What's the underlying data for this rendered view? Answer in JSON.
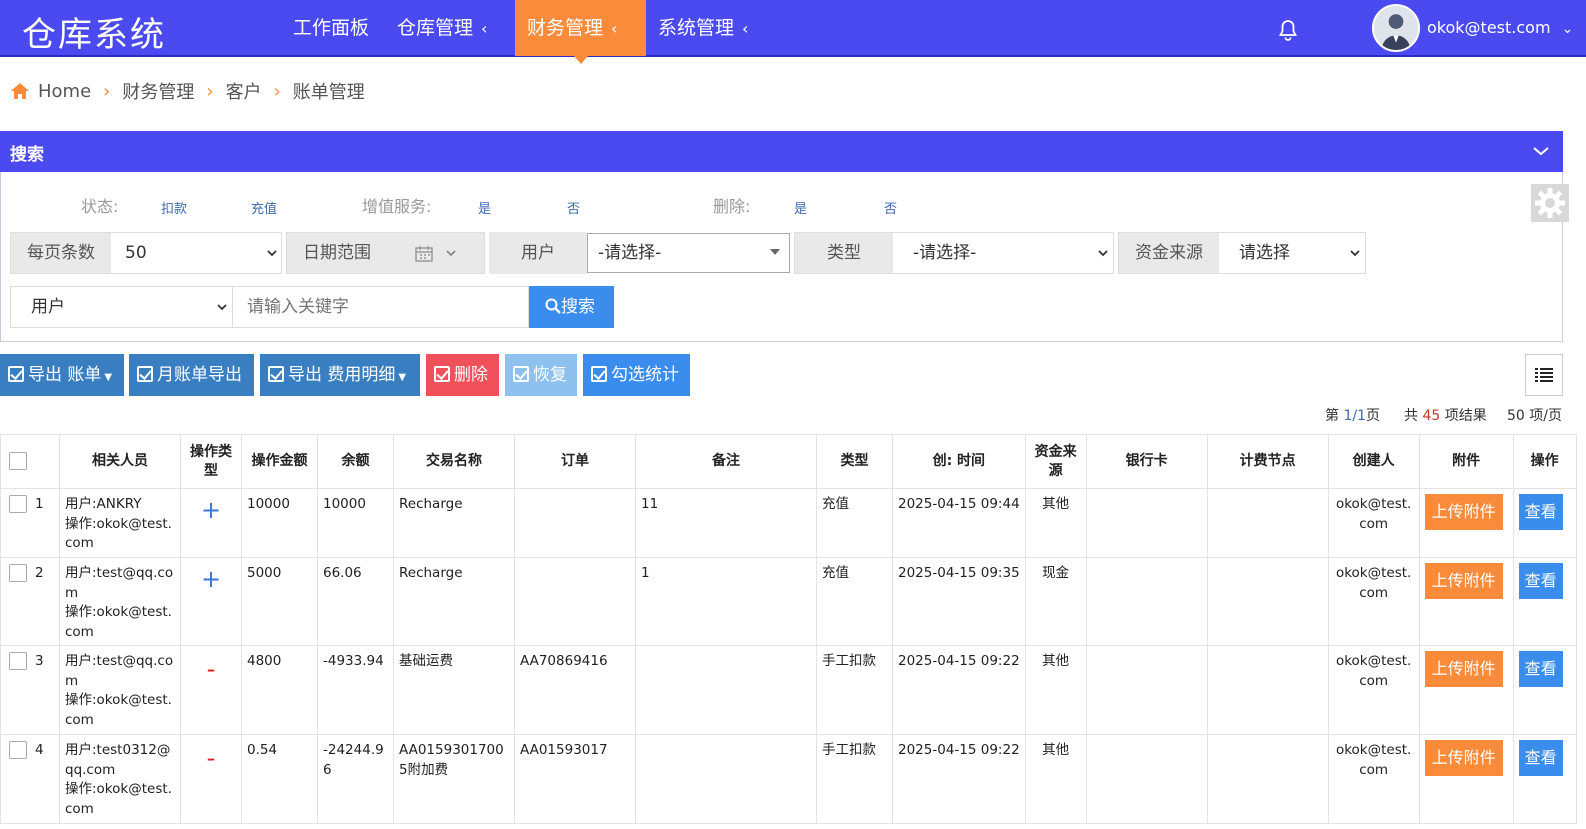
{
  "app": {
    "title": "仓库系统"
  },
  "nav": {
    "items": [
      {
        "label": "工作面板",
        "has_chevron": false
      },
      {
        "label": "仓库管理",
        "has_chevron": true
      },
      {
        "label": "财务管理",
        "has_chevron": true,
        "active": true
      },
      {
        "label": "系统管理",
        "has_chevron": true
      }
    ],
    "chevron": "‹",
    "user_email": "okok@test.com",
    "user_caret": "⌄"
  },
  "breadcrumb": [
    "Home",
    "财务管理",
    "客户",
    "账单管理"
  ],
  "search": {
    "title": "搜索",
    "filters": {
      "status_label": "状态:",
      "status_options": [
        "扣款",
        "充值"
      ],
      "vas_label": "增值服务:",
      "vas_options": [
        "是",
        "否"
      ],
      "delete_label": "删除:",
      "delete_options": [
        "是",
        "否"
      ]
    },
    "per_page_label": "每页条数",
    "per_page_value": "50",
    "date_range_label": "日期范围",
    "user_label": "用户",
    "user_value": "-请选择-",
    "type_label": "类型",
    "type_value": "-请选择-",
    "fund_label": "资金来源",
    "fund_value": "请选择",
    "keyword_field": "用户",
    "keyword_placeholder": "请输入关键字",
    "search_button": "搜索"
  },
  "toolbar": {
    "export_bill": "导出 账单",
    "monthly_export": "月账单导出",
    "export_fee_detail": "导出 费用明细",
    "delete": "删除",
    "restore": "恢复",
    "check_stats": "勾选统计"
  },
  "pagination": {
    "page_prefix": "第",
    "page_value": "1/1",
    "page_suffix": "页",
    "total_prefix": "共",
    "total_value": "45",
    "total_suffix": "项结果",
    "per_page_text": "50 项/页"
  },
  "table": {
    "columns": [
      "相关人员",
      "操作类型",
      "操作金额",
      "余额",
      "交易名称",
      "订单",
      "备注",
      "类型",
      "创: 时间",
      "资金来源",
      "银行卡",
      "计费节点",
      "创建人",
      "附件",
      "操作"
    ],
    "upload_label": "上传附件",
    "view_label": "查看",
    "rows": [
      {
        "no": "1",
        "person": "用户:ANKRY\n操作:okok@test.com",
        "op": "+",
        "amount": "10000",
        "balance": "10000",
        "txn": "Recharge",
        "order": "",
        "remark": "11",
        "type": "充值",
        "time": "2025-04-15 09:44",
        "fund": "其他",
        "card": "",
        "node": "",
        "creator": "okok@test.com"
      },
      {
        "no": "2",
        "person": "用户:test@qq.com\n操作:okok@test.com",
        "op": "+",
        "amount": "5000",
        "balance": "66.06",
        "txn": "Recharge",
        "order": "",
        "remark": "1",
        "type": "充值",
        "time": "2025-04-15 09:35",
        "fund": "现金",
        "card": "",
        "node": "",
        "creator": "okok@test.com"
      },
      {
        "no": "3",
        "person": "用户:test@qq.com\n操作:okok@test.com",
        "op": "-",
        "amount": "4800",
        "balance": "-4933.94",
        "txn": "基础运费",
        "order": "AA70869416",
        "remark": "",
        "type": "手工扣款",
        "time": "2025-04-15 09:22",
        "fund": "其他",
        "card": "",
        "node": "",
        "creator": "okok@test.com"
      },
      {
        "no": "4",
        "person": "用户:test0312@qq.com\n操作:okok@test.com",
        "op": "-",
        "amount": "0.54",
        "balance": "-24244.96",
        "txn": "AA01593017005附加费",
        "order": "AA01593017",
        "remark": "",
        "type": "手工扣款",
        "time": "2025-04-15 09:22",
        "fund": "其他",
        "card": "",
        "node": "",
        "creator": "okok@test.com"
      }
    ]
  },
  "colors": {
    "primary": "#4a4af0",
    "accent": "#f98b3b",
    "danger": "#f0505a",
    "info": "#3b8ded",
    "steel": "#3a7ec2"
  }
}
